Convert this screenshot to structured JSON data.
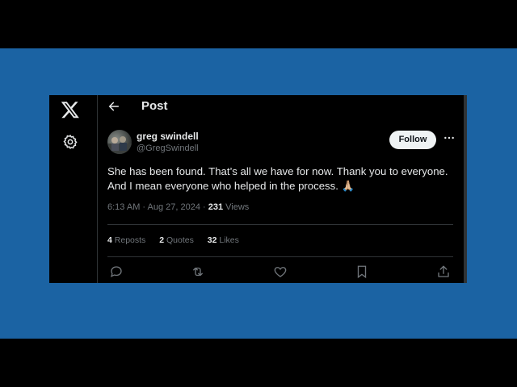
{
  "page": {
    "title": "Post"
  },
  "sidebar": {
    "icons": [
      "x-logo-icon",
      "gear-icon"
    ]
  },
  "author": {
    "name": "greg swindell",
    "handle": "@GregSwindell"
  },
  "follow_label": "Follow",
  "tweet": {
    "line1": "She has been found. That’s all we have for now. Thank you to everyone.",
    "line2": "And I mean everyone who helped in the process. 🙏🏼"
  },
  "meta": {
    "time": "6:13 AM · Aug 27, 2024 · ",
    "views_count": "231",
    "views_label": " Views"
  },
  "stats": {
    "reposts_count": "4",
    "reposts_label": "Reposts",
    "quotes_count": "2",
    "quotes_label": "Quotes",
    "likes_count": "32",
    "likes_label": "Likes"
  },
  "actions": [
    "reply-icon",
    "repost-icon",
    "like-icon",
    "bookmark-icon",
    "share-icon"
  ],
  "colors": {
    "background_blue": "#1b63a3",
    "panel": "#000000",
    "text": "#e7e9ea",
    "muted": "#71767b",
    "divider": "#2f3336"
  }
}
